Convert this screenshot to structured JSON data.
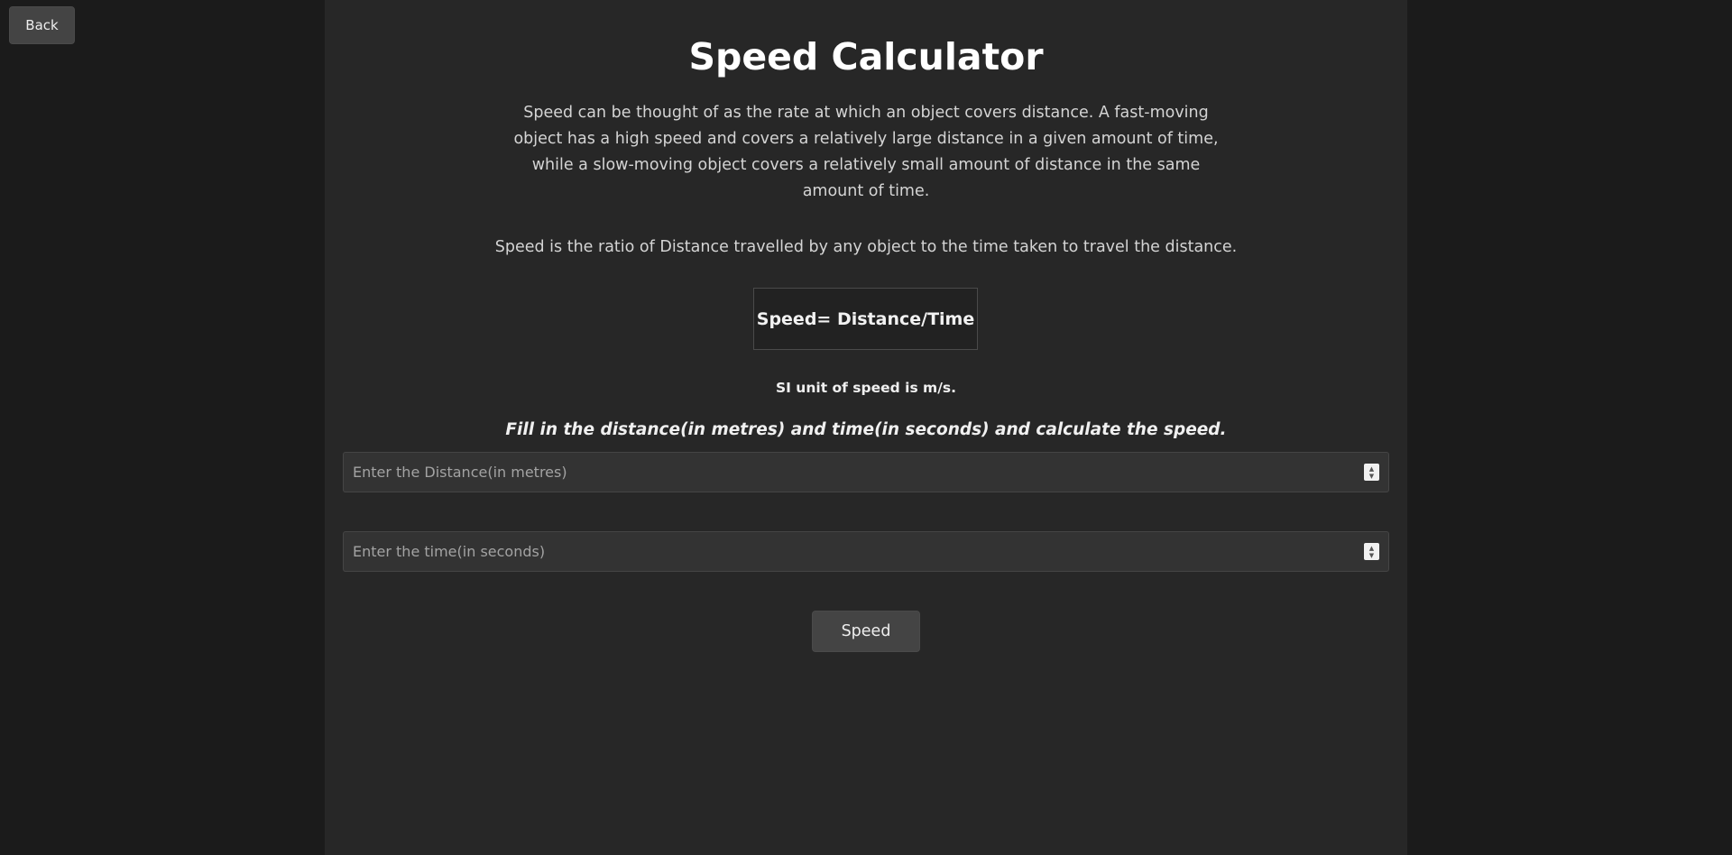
{
  "nav": {
    "back_label": "Back"
  },
  "main": {
    "title": "Speed Calculator",
    "description": "Speed can be thought of as the rate at which an object covers distance. A fast-moving object has a high speed and covers a relatively large distance in a given amount of time, while a slow-moving object covers a relatively small amount of distance in the same amount of time.",
    "ratio_text": "Speed is the ratio of Distance travelled by any object to the time taken to travel the distance.",
    "formula": "Speed= Distance/Time",
    "si_unit": "SI unit of speed is m/s.",
    "instruction": "Fill in the distance(in metres) and time(in seconds) and calculate the speed."
  },
  "form": {
    "distance": {
      "placeholder": "Enter the Distance(in metres)",
      "value": ""
    },
    "time": {
      "placeholder": "Enter the time(in seconds)",
      "value": ""
    },
    "submit_label": "Speed"
  },
  "colors": {
    "page_background": "#1b1b1b",
    "panel_background": "#272727",
    "button_background": "#444444",
    "input_background": "#333333"
  }
}
